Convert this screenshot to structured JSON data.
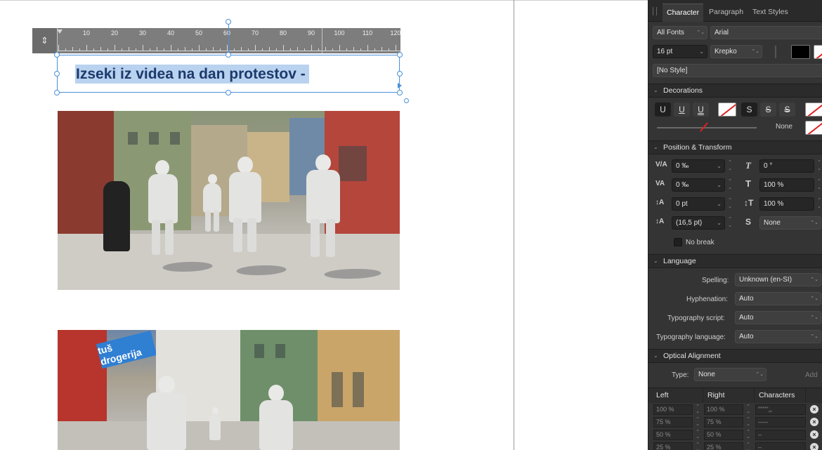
{
  "canvas": {
    "ruler": {
      "numbers": [
        "10",
        "20",
        "30",
        "40",
        "50",
        "60",
        "70",
        "80",
        "90",
        "100",
        "110",
        "120"
      ]
    },
    "selected_text": "Izseki iz videa na dan protestov -",
    "photo2_sign": "tuš drogerija"
  },
  "panel": {
    "tabs": [
      "Character",
      "Paragraph",
      "Text Styles"
    ],
    "font": {
      "collection": "All Fonts",
      "family": "Arial",
      "size": "16 pt",
      "weight": "Krepko",
      "style": "[No Style]"
    },
    "decorations": {
      "title": "Decorations",
      "underline_labels": [
        "U",
        "U",
        "U"
      ],
      "strike_labels": [
        "S",
        "S",
        "S"
      ],
      "line_style": "None"
    },
    "position_transform": {
      "title": "Position & Transform",
      "tracking": "0 ‰",
      "shear": "0 °",
      "kerning": "0 ‰",
      "horizontal_scale": "100 %",
      "baseline": "0 pt",
      "vertical_scale": "100 %",
      "leading": "(16,5 pt)",
      "superscript": "None",
      "no_break": "No break"
    },
    "language": {
      "title": "Language",
      "spelling_label": "Spelling:",
      "spelling": "Unknown (en-SI)",
      "hyphenation_label": "Hyphenation:",
      "hyphenation": "Auto",
      "script_label": "Typography script:",
      "script": "Auto",
      "lang_label": "Typography language:",
      "lang": "Auto"
    },
    "optical": {
      "title": "Optical Alignment",
      "type_label": "Type:",
      "type": "None",
      "add": "Add",
      "headers": [
        "Left",
        "Right",
        "Characters"
      ],
      "rows": [
        {
          "left": "100 %",
          "right": "100 %",
          "chars": "\"\"\"'''‚„"
        },
        {
          "left": "75 %",
          "right": "75 %",
          "chars": "–—"
        },
        {
          "left": "50 %",
          "right": "50 %",
          "chars": "–"
        },
        {
          "left": "25 %",
          "right": "25 %",
          "chars": "–"
        }
      ]
    },
    "colors": {
      "fill": "#000000",
      "accent": "#4a90d9",
      "none_slash": "#e02020"
    }
  }
}
